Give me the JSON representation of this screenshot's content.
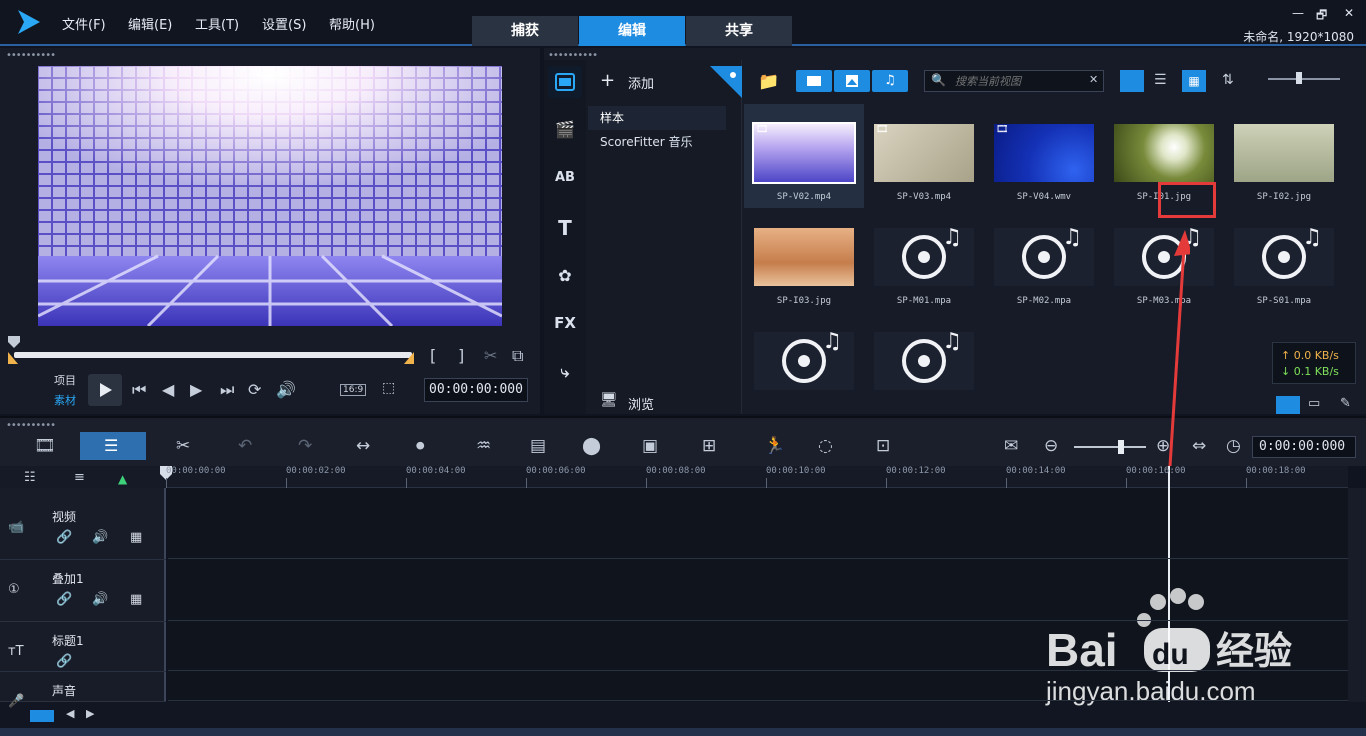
{
  "menu": [
    "文件(F)",
    "编辑(E)",
    "工具(T)",
    "设置(S)",
    "帮助(H)"
  ],
  "mode_tabs": [
    "捕获",
    "编辑",
    "共享"
  ],
  "window_controls": [
    "—",
    "🗗",
    "✕"
  ],
  "project_info": "未命名, 1920*1080",
  "player": {
    "mode_project": "项目",
    "mode_clip": "素材",
    "aspect": "16:9",
    "timecode": "00:00:00:000"
  },
  "library": {
    "add_label": "添加",
    "folders": [
      "样本",
      "ScoreFitter 音乐"
    ],
    "browse_label": "浏览",
    "search_placeholder": "搜索当前视图",
    "side_icons": [
      "media-icon",
      "transition-icon",
      "title-ab-icon",
      "text-icon",
      "graphics-icon",
      "FX",
      "path-icon"
    ],
    "items": [
      {
        "name": "SP-V02.mp4",
        "kind": "video"
      },
      {
        "name": "SP-V03.mp4",
        "kind": "video"
      },
      {
        "name": "SP-V04.wmv",
        "kind": "video"
      },
      {
        "name": "SP-I01.jpg",
        "kind": "image"
      },
      {
        "name": "SP-I02.jpg",
        "kind": "image"
      },
      {
        "name": "SP-I03.jpg",
        "kind": "image"
      },
      {
        "name": "SP-M01.mpa",
        "kind": "audio"
      },
      {
        "name": "SP-M02.mpa",
        "kind": "audio"
      },
      {
        "name": "SP-M03.mpa",
        "kind": "audio"
      },
      {
        "name": "SP-S01.mpa",
        "kind": "audio"
      },
      {
        "name": "",
        "kind": "audio"
      },
      {
        "name": "",
        "kind": "audio"
      }
    ],
    "speed_up": "↑ 0.0 KB/s",
    "speed_down": "↓ 0.1 KB/s"
  },
  "timeline": {
    "timecode": "0:00:00:000",
    "ruler": [
      "00:00:00:00",
      "00:00:02:00",
      "00:00:04:00",
      "00:00:06:00",
      "00:00:08:00",
      "00:00:10:00",
      "00:00:12:00",
      "00:00:14:00",
      "00:00:16:00",
      "00:00:18:00"
    ],
    "tracks": [
      "视频",
      "叠加1",
      "标题1",
      "声音"
    ]
  },
  "watermark": {
    "brand": "Bai du 经验",
    "url": "jingyan.baidu.com"
  }
}
